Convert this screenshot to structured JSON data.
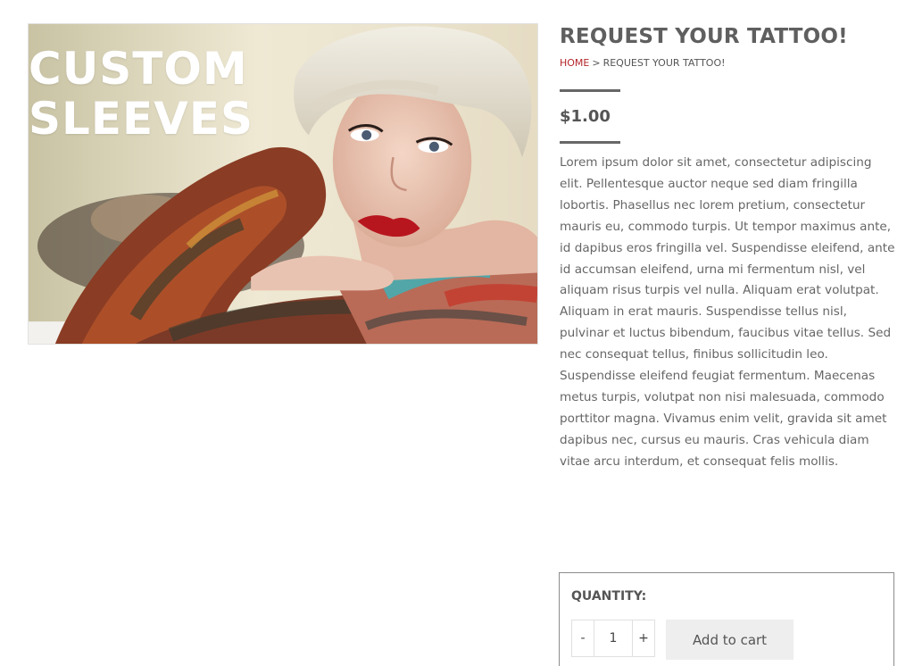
{
  "product": {
    "image": {
      "overlay_line_1": "CUSTOM",
      "overlay_line_2": "SLEEVES"
    },
    "title": "REQUEST YOUR TATTOO!",
    "breadcrumb": {
      "home": "HOME",
      "separator": ">",
      "current": "REQUEST YOUR TATTOO!"
    },
    "price": "$1.00",
    "description": "Lorem ipsum dolor sit amet, consectetur adipiscing elit. Pellentesque auctor neque sed diam fringilla lobortis. Phasellus nec lorem pretium, consectetur mauris eu, commodo turpis. Ut tempor maximus ante, id dapibus eros fringilla vel. Suspendisse eleifend, ante id accumsan eleifend, urna mi fermentum nisl, vel aliquam risus turpis vel nulla. Aliquam erat volutpat. Aliquam in erat mauris. Suspendisse tellus nisl, pulvinar et luctus bibendum, faucibus vitae tellus. Sed nec consequat tellus, finibus sollicitudin leo. Suspendisse eleifend feugiat fermentum. Maecenas metus turpis, volutpat non nisi malesuada, commodo porttitor magna. Vivamus enim velit, gravida sit amet dapibus nec, cursus eu mauris. Cras vehicula diam vitae arcu interdum, et consequat felis mollis."
  },
  "cart": {
    "quantity_label": "QUANTITY:",
    "minus": "-",
    "plus": "+",
    "quantity_value": "1",
    "add_to_cart_label": "Add to cart"
  },
  "colors": {
    "breadcrumb_home": "#b4262b",
    "heading": "#5f5f5f",
    "body_text": "#666666",
    "button_bg": "#eeeeee"
  }
}
